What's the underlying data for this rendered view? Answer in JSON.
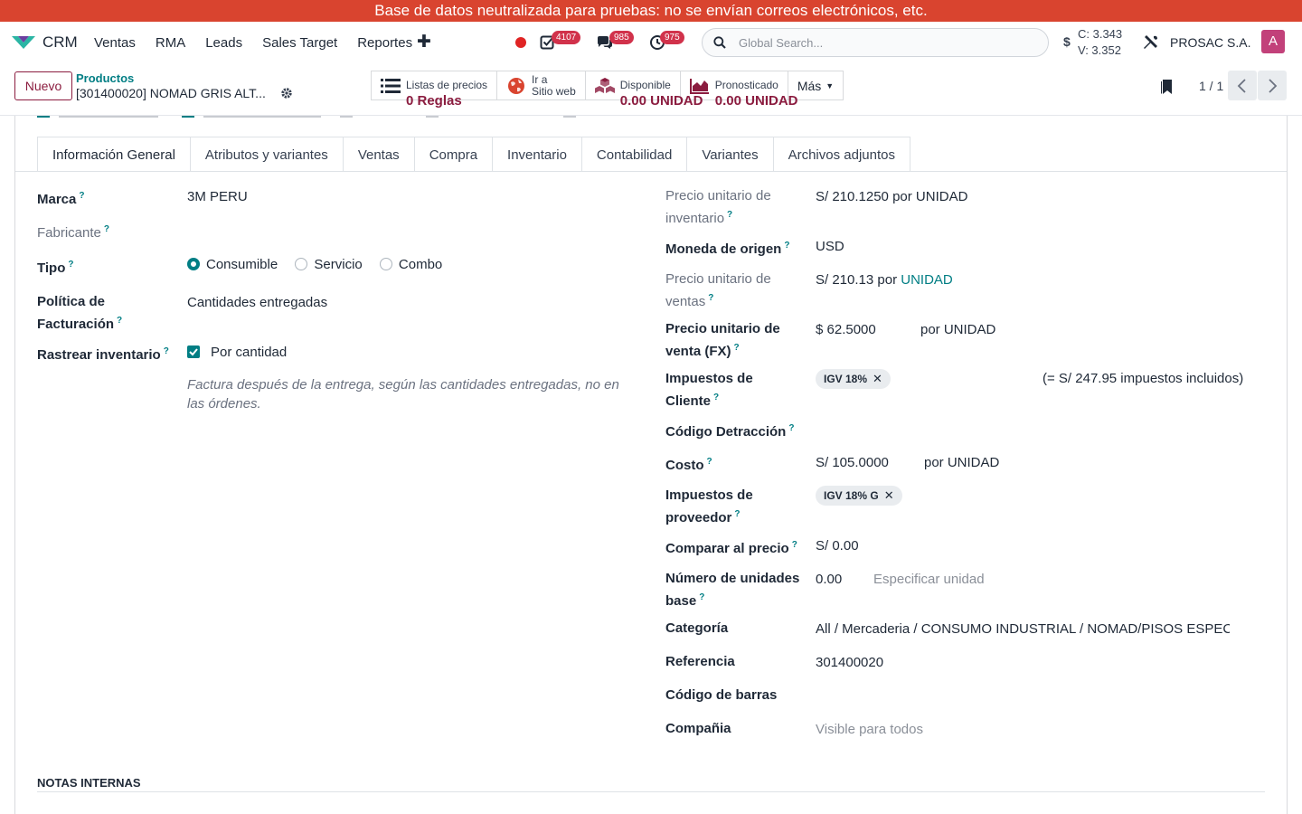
{
  "banner": "Base de datos neutralizada para pruebas: no se envían correos electrónicos, etc.",
  "navbar": {
    "app_name": "CRM",
    "menu": [
      "Ventas",
      "RMA",
      "Leads",
      "Sales Target",
      "Reportes"
    ],
    "badges": {
      "activities": "4107",
      "messages": "985",
      "timesheet": "975"
    },
    "search_placeholder": "Global Search...",
    "fx_symbol": "$",
    "fx_buy": "C: 3.343",
    "fx_sell": "V: 3.352",
    "company": "PROSAC S.A.",
    "avatar": "A"
  },
  "control": {
    "new_button": "Nuevo",
    "breadcrumb_parent": "Productos",
    "breadcrumb_current": "[301400020] NOMAD GRIS ALT...",
    "smart_buttons": [
      {
        "line1": "Listas de precios",
        "line2": "0  Reglas",
        "icon": "list-icon"
      },
      {
        "line1": "Ir a",
        "line2": "Sitio web",
        "icon": "globe-icon"
      },
      {
        "line1": "Disponible",
        "line2": "0.00 UNIDAD",
        "icon": "cubes-icon"
      },
      {
        "line1": "Pronosticado",
        "line2": "0.00 UNIDAD",
        "icon": "area-chart-icon"
      }
    ],
    "more": "Más",
    "pager": "1 / 1"
  },
  "tabs": [
    "Información General",
    "Atributos y variantes",
    "Ventas",
    "Compra",
    "Inventario",
    "Contabilidad",
    "Variantes",
    "Archivos adjuntos"
  ],
  "left": {
    "marca_label": "Marca",
    "marca_value": "3M PERU",
    "fabricante_label": "Fabricante",
    "tipo_label": "Tipo",
    "tipo_options": [
      "Consumible",
      "Servicio",
      "Combo"
    ],
    "tipo_selected": "Consumible",
    "politica_label_1": "Política de",
    "politica_label_2": "Facturación",
    "politica_value": "Cantidades entregadas",
    "rastrear_label": "Rastrear inventario",
    "rastrear_value": "Por cantidad",
    "rastrear_checked": true,
    "help_text": "Factura después de la entrega, según las cantidades entregadas, no en las órdenes."
  },
  "right": {
    "precio_inv_label_1": "Precio unitario de",
    "precio_inv_label_2": "inventario",
    "precio_inv_value": "S/ 210.1250 por UNIDAD",
    "moneda_label": "Moneda de origen",
    "moneda_value": "USD",
    "precio_ventas_label_1": "Precio unitario de",
    "precio_ventas_label_2": "ventas",
    "precio_ventas_value": "S/ 210.13 por ",
    "precio_ventas_unit": "UNIDAD",
    "precio_fx_label_1": "Precio unitario de",
    "precio_fx_label_2": "venta (FX)",
    "precio_fx_value": "$ 62.5000",
    "precio_fx_unit": "por UNIDAD",
    "imp_cliente_label_1": "Impuestos de",
    "imp_cliente_label_2": "Cliente",
    "imp_cliente_tag": "IGV 18%",
    "imp_cliente_total": "(= S/ 247.95 impuestos incluidos)",
    "detraccion_label": "Código Detracción",
    "costo_label": "Costo",
    "costo_value": "S/ 105.0000",
    "costo_unit": "por UNIDAD",
    "imp_prov_label_1": "Impuestos de",
    "imp_prov_label_2": "proveedor",
    "imp_prov_tag": "IGV 18% G",
    "comparar_label": "Comparar al precio",
    "comparar_value": "S/ 0.00",
    "unidades_label_1": "Número de unidades",
    "unidades_label_2": "base",
    "unidades_value": "0.00",
    "unidades_placeholder": "Especificar unidad",
    "categoria_label": "Categoría",
    "categoria_value": "All / Mercaderia / CONSUMO INDUSTRIAL / NOMAD/PISOS ESPECIALES",
    "referencia_label": "Referencia",
    "referencia_value": "301400020",
    "barras_label": "Código de barras",
    "compania_label": "Compañia",
    "compania_placeholder": "Visible para todos"
  },
  "notes_title": "NOTAS INTERNAS",
  "colors": {
    "banner": "#d9442f",
    "primary": "#8b1c3f",
    "teal": "#017e84"
  }
}
